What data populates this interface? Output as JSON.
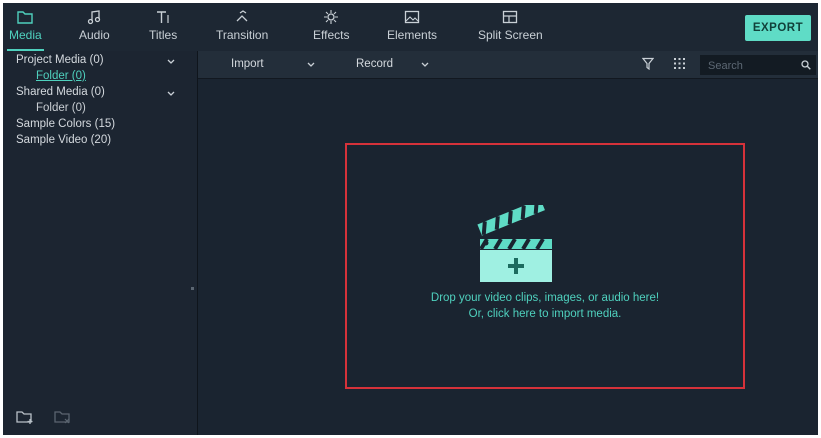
{
  "topbar": {
    "tabs": [
      {
        "label": "Media",
        "icon": "folder-icon",
        "active": true
      },
      {
        "label": "Audio",
        "icon": "music-note-icon"
      },
      {
        "label": "Titles",
        "icon": "text-icon"
      },
      {
        "label": "Transition",
        "icon": "transition-icon"
      },
      {
        "label": "Effects",
        "icon": "effects-icon"
      },
      {
        "label": "Elements",
        "icon": "image-icon"
      },
      {
        "label": "Split Screen",
        "icon": "split-screen-icon"
      }
    ],
    "export_label": "EXPORT"
  },
  "sidebar": {
    "items": [
      {
        "label": "Project Media (0)"
      },
      {
        "label": "Folder (0)"
      },
      {
        "label": "Shared Media (0)"
      },
      {
        "label": "Folder (0)"
      },
      {
        "label": "Sample Colors (15)"
      },
      {
        "label": "Sample Video (20)"
      }
    ]
  },
  "content_bar": {
    "import_label": "Import",
    "record_label": "Record",
    "search_placeholder": "Search"
  },
  "dropzone": {
    "line1": "Drop your video clips, images, or audio here!",
    "line2": "Or, click here to import media."
  },
  "colors": {
    "accent": "#4fd1be",
    "background": "#1a2430",
    "dropzone_border": "#d6323a"
  }
}
